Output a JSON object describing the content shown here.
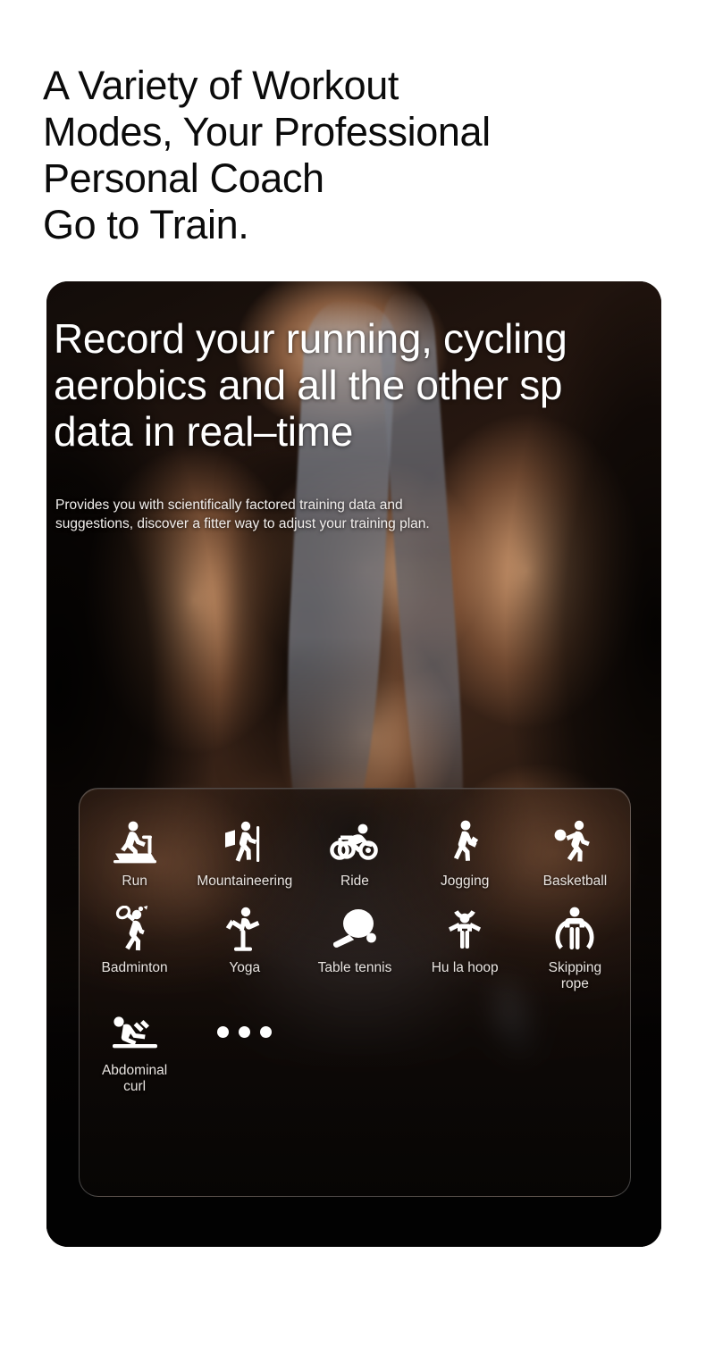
{
  "page": {
    "heading": "A Variety of Workout\nModes, Your Professional\nPersonal Coach\nGo to Train."
  },
  "hero": {
    "title": "Record your running, cycling\naerobics and all the other sp\ndata in real–time",
    "subtitle": "Provides you with scientifically factored training data and\nsuggestions, discover a fitter way to adjust your training plan.",
    "photo_alt": "muscular-man-seated-with-towel",
    "device": {
      "name": "smartwatch-on-wrist",
      "screen_label": "workout-stats"
    },
    "colors": {
      "card_background": "#0a0706",
      "heading_text": "#0b0b0b",
      "hero_text": "#ffffff",
      "label_text": "#e9e4e0",
      "panel_border": "rgba(255,255,255,0.26)"
    }
  },
  "modes_panel": {
    "items": [
      {
        "label": "Run",
        "icon": "treadmill-run-icon"
      },
      {
        "label": "Mountaineering",
        "icon": "mountaineering-hiker-icon"
      },
      {
        "label": "Ride",
        "icon": "cycling-ride-icon"
      },
      {
        "label": "Jogging",
        "icon": "jogging-walk-icon"
      },
      {
        "label": "Basketball",
        "icon": "basketball-icon"
      },
      {
        "label": "Badminton",
        "icon": "badminton-icon"
      },
      {
        "label": "Yoga",
        "icon": "yoga-icon"
      },
      {
        "label": "Table tennis",
        "icon": "table-tennis-icon"
      },
      {
        "label": "Hu la hoop",
        "icon": "hula-hoop-icon"
      },
      {
        "label": "Skipping\nrope",
        "icon": "skipping-rope-icon"
      },
      {
        "label": "Abdominal\ncurl",
        "icon": "abdominal-curl-icon"
      },
      {
        "label": "",
        "icon": "more-dots-icon"
      }
    ]
  }
}
